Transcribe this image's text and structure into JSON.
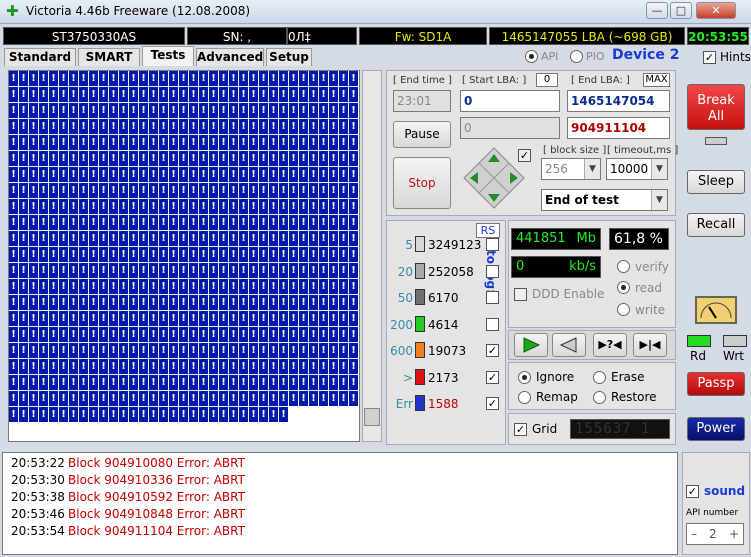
{
  "window": {
    "title": "Victoria 4.46b Freeware (12.08.2008)",
    "minimize": "—",
    "maximize": "□",
    "close": "✕"
  },
  "infobar": {
    "model": "ST3750330AS",
    "serial": "SN: ,",
    "counter": "0Л‡",
    "firmware": "Fw: SD1A",
    "lba": "1465147055 LBA (~698 GB)",
    "clock": "20:53:55"
  },
  "tabs": [
    "Standard",
    "SMART",
    "Tests",
    "Advanced",
    "Setup"
  ],
  "active_tab": "Tests",
  "port": {
    "api_label": "API",
    "pio_label": "PIO",
    "device": "Device 2",
    "hints_label": "Hints"
  },
  "grid": {
    "glyph": "!",
    "full_rows": 21,
    "last_row_cells": 28,
    "columns": 35
  },
  "time": {
    "end_time_label": "[ End time ]",
    "end_time": "23:01",
    "start_lba_label": "[ Start LBA: ]",
    "start_lba_box": "0",
    "start_lba": "0",
    "end_lba_label": "[ End LBA: ]",
    "max_label": "MAX",
    "end_lba": "1465147054",
    "pos_disabled": "0",
    "current_lba": "904911104"
  },
  "buttons": {
    "pause": "Pause",
    "stop": "Stop",
    "break_all": "Break All",
    "sleep": "Sleep",
    "recall": "Recall",
    "passp": "Passp",
    "power": "Power",
    "rs": "RS"
  },
  "block": {
    "block_size_label": "[ block size ]",
    "block_size": "256",
    "timeout_label": "[ timeout,ms ]",
    "timeout": "10000",
    "mode": "End of test"
  },
  "stats": {
    "to_log_label": "to log:",
    "rows": [
      {
        "label": "5",
        "count": "3249123",
        "color": "#d8d8d8",
        "checked": false
      },
      {
        "label": "20",
        "count": "252058",
        "color": "#a8a8a8",
        "checked": false
      },
      {
        "label": "50",
        "count": "6170",
        "color": "#707070",
        "checked": false
      },
      {
        "label": "200",
        "count": "4614",
        "color": "#22cc22",
        "checked": false
      },
      {
        "label": "600",
        "count": "19073",
        "color": "#f08020",
        "checked": true
      },
      {
        "label": ">",
        "count": "2173",
        "color": "#dd1111",
        "checked": true
      },
      {
        "label": "Err",
        "count": "1588",
        "color": "#2233cc",
        "checked": true
      }
    ]
  },
  "progress": {
    "mb": "441851",
    "mb_unit": "Mb",
    "percent": "61,8 %",
    "speed": "0",
    "speed_unit": "kb/s",
    "verify": "verify",
    "read": "read",
    "write": "write",
    "ddd": "DDD Enable"
  },
  "actions": {
    "ignore": "Ignore",
    "erase": "Erase",
    "remap": "Remap",
    "restore": "Restore",
    "grid_label": "Grid",
    "grid_counter": "155637 1"
  },
  "leds": {
    "rd": "Rd",
    "wrt": "Wrt"
  },
  "sound": {
    "label": "sound",
    "api_number_label": "API number",
    "api_number": "2"
  },
  "log": [
    {
      "time": "20:53:22",
      "msg": "Block 904910080 Error: ABRT"
    },
    {
      "time": "20:53:30",
      "msg": "Block 904910336 Error: ABRT"
    },
    {
      "time": "20:53:38",
      "msg": "Block 904910592 Error: ABRT"
    },
    {
      "time": "20:53:46",
      "msg": "Block 904910848 Error: ABRT"
    },
    {
      "time": "20:53:54",
      "msg": "Block 904911104 Error: ABRT"
    }
  ],
  "colors": {
    "grid_blue": "#0019a8",
    "error_red": "#c00000",
    "break_red": "#e01818",
    "power_blue": "#0a1a8a"
  }
}
